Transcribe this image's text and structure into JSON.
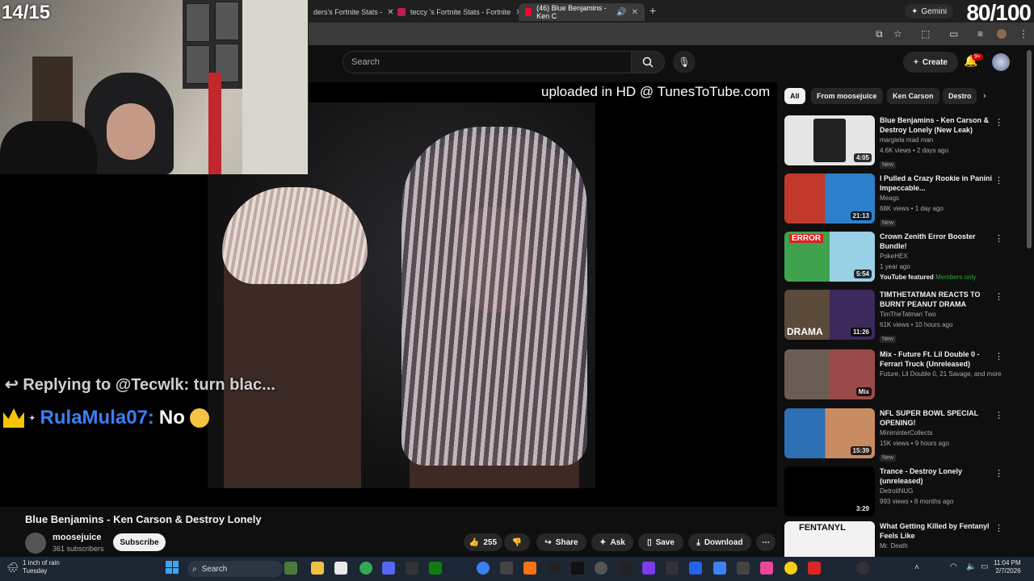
{
  "overlay": {
    "counter": "14/15",
    "score": "80/100"
  },
  "browser": {
    "tabs": [
      {
        "label": "ders's Fortnite Stats -",
        "color": "#2f6fd6"
      },
      {
        "label": "teccy   's Fortnite Stats - Fortnite",
        "color": "#c2185b"
      },
      {
        "label": "(46) Blue Benjamins - Ken C",
        "color": "#ff0033"
      }
    ],
    "new_tab": "+",
    "gemini": "Gemini"
  },
  "youtube": {
    "search_placeholder": "Search",
    "create_label": "Create",
    "notif_count": "9+"
  },
  "video": {
    "watermark": "uploaded in HD @ TunesToTube.com",
    "reply_line": "Replying to @Tecwlk: turn blac...",
    "chat_user": "RulaMula07:",
    "chat_message": "No",
    "title": "Blue Benjamins - Ken Carson & Destroy Lonely",
    "channel": "moosejuice",
    "subscribers": "361 subscribers",
    "subscribe_label": "Subscribe",
    "likes": "255",
    "share_label": "Share",
    "ask_label": "Ask",
    "save_label": "Save",
    "download_label": "Download"
  },
  "chips": [
    "All",
    "From moosejuice",
    "Ken Carson",
    "Destro"
  ],
  "recommendations": [
    {
      "title": "Blue Benjamins - Ken Carson & Destroy Lonely  (New Leak)",
      "channel": "margiela mad man",
      "meta": "4.6K views • 2 days ago",
      "badge": "New",
      "duration": "4:05",
      "thumb": "#e6e6e6"
    },
    {
      "title": "I Pulled a Crazy Rookie in Panini Impeccable...",
      "channel": "Meags",
      "meta": "68K views • 1 day ago",
      "badge": "New",
      "duration": "21:13",
      "thumb": "#c0392b"
    },
    {
      "title": "Crown Zenith Error Booster Bundle!",
      "channel": "PokeHEX",
      "meta": "1 year ago",
      "badge": "YouTube featured",
      "member": "Members only",
      "duration": "5:54",
      "thumb": "#3fa34d"
    },
    {
      "title": "TIMTHETATMAN REACTS TO BURNT PEANUT DRAMA",
      "channel": "TimTheTatman Two",
      "meta": "61K views • 10 hours ago",
      "badge": "New",
      "duration": "11:26",
      "thumb": "#5a4a3a"
    },
    {
      "title": "Mix - Future Ft. Lil Double 0 - Ferrari Truck (Unreleased)",
      "channel": "Future, Lil Double 0, 21 Savage, and more",
      "meta": "",
      "badge": "",
      "duration": "Mix",
      "thumb": "#6b5c55"
    },
    {
      "title": "NFL SUPER BOWL SPECIAL OPENING!",
      "channel": "MiniminterCollects",
      "meta": "15K views • 9 hours ago",
      "badge": "New",
      "duration": "15:39",
      "thumb": "#2d6fb5"
    },
    {
      "title": "Trance - Destroy Lonely (unreleased)",
      "channel": "DetroitNUG",
      "meta": "993 views • 8 months ago",
      "badge": "",
      "duration": "3:29",
      "thumb": "#000000"
    },
    {
      "title": "What Getting Killed by Fentanyl Feels Like",
      "channel": "Mr. Death",
      "meta": "",
      "badge": "",
      "duration": "",
      "thumb": "#f2f2f2",
      "thumb_text": "FENTANYL"
    }
  ],
  "taskbar": {
    "weather_line1": "1 inch of rain",
    "weather_line2": "Tuesday",
    "search_label": "Search",
    "time": "11:04 PM",
    "date": "2/7/2026"
  }
}
